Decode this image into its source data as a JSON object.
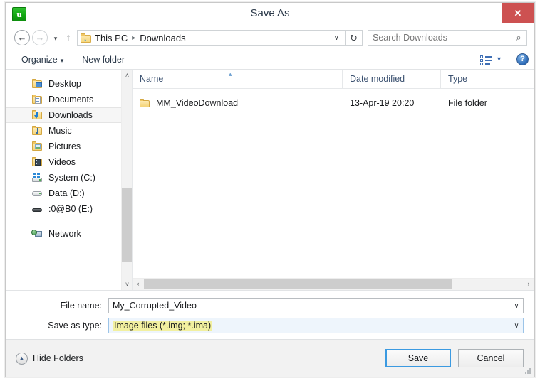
{
  "window": {
    "title": "Save As",
    "app_icon": "utorrent-icon",
    "app_icon_letter": "u",
    "close_label": "✕"
  },
  "address_bar": {
    "back_icon": "←",
    "forward_icon": "→",
    "history_caret": "▾",
    "up_icon": "↑",
    "folder_icon": "downloads-folder-icon",
    "breadcrumbs": [
      {
        "label": "This PC"
      },
      {
        "label": "Downloads"
      }
    ],
    "separator": "▸",
    "dropdown_caret": "∨",
    "refresh_icon": "↻",
    "search_placeholder": "Search Downloads",
    "search_value": "",
    "search_icon": "⌕"
  },
  "toolbar": {
    "organize_label": "Organize",
    "organize_caret": "▾",
    "new_folder_label": "New folder",
    "view_caret": "▾",
    "help_label": "?"
  },
  "sidebar": {
    "items": [
      {
        "label": "Desktop",
        "icon": "desktop-folder-icon",
        "selected": false
      },
      {
        "label": "Documents",
        "icon": "documents-folder-icon",
        "selected": false
      },
      {
        "label": "Downloads",
        "icon": "downloads-folder-icon",
        "selected": true
      },
      {
        "label": "Music",
        "icon": "music-folder-icon",
        "selected": false
      },
      {
        "label": "Pictures",
        "icon": "pictures-folder-icon",
        "selected": false
      },
      {
        "label": "Videos",
        "icon": "videos-folder-icon",
        "selected": false
      },
      {
        "label": "System (C:)",
        "icon": "windows-drive-icon",
        "selected": false
      },
      {
        "label": "Data (D:)",
        "icon": "hard-drive-icon",
        "selected": false
      },
      {
        "label": ":0@B0 (E:)",
        "icon": "removable-drive-icon",
        "selected": false
      },
      {
        "label": "Network",
        "icon": "network-icon",
        "selected": false,
        "gap_before": true
      }
    ],
    "scroll_up_icon": "˄",
    "scroll_down_icon": "˅"
  },
  "file_list": {
    "columns": [
      {
        "key": "name",
        "label": "Name"
      },
      {
        "key": "date",
        "label": "Date modified"
      },
      {
        "key": "type",
        "label": "Type"
      }
    ],
    "sort_indicator": "▴",
    "rows": [
      {
        "icon": "folder-icon",
        "name": "MM_VideoDownload",
        "date": "13-Apr-19 20:20",
        "type": "File folder"
      }
    ],
    "hscroll_left_icon": "‹",
    "hscroll_right_icon": "›"
  },
  "form": {
    "file_name_label": "File name:",
    "file_name_value": "My_Corrupted_Video",
    "save_as_type_label": "Save as type:",
    "save_as_type_value": "Image files (*.img; *.ima)",
    "caret": "∨"
  },
  "footer": {
    "hide_folders_label": "Hide Folders",
    "hide_folders_icon": "▲",
    "save_label": "Save",
    "cancel_label": "Cancel"
  },
  "colors": {
    "accent_blue": "#3b9ae1",
    "close_red": "#cd5151",
    "highlight_yellow": "#f2f0a0",
    "header_text": "#3b5170",
    "app_green": "#13a813"
  }
}
